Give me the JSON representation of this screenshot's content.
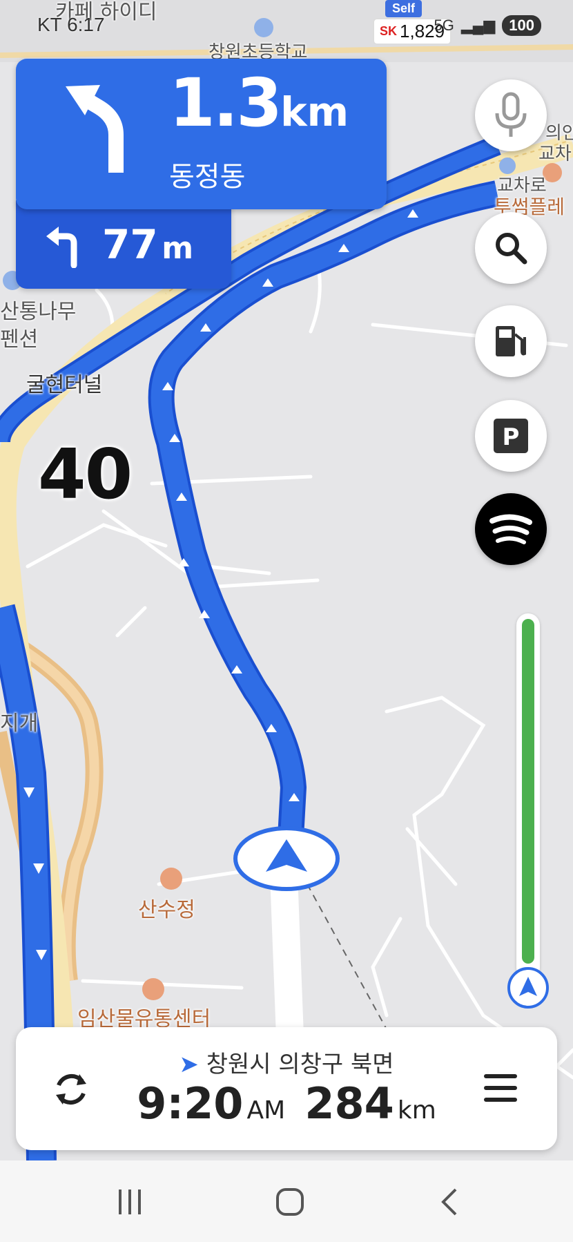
{
  "status_bar": {
    "carrier": "KT",
    "time": "6:17",
    "self_badge": "Self",
    "gas_brand": "SK",
    "gas_price": "1,829",
    "network": "5G",
    "battery": "100"
  },
  "map_labels": {
    "cafe": "카페 하이디",
    "school": "창원초등학교",
    "tunnel": "굴현터널",
    "pension_1": "산통나무",
    "pension_2": "펜션",
    "jigae": "지개",
    "sansujeong": "산수정",
    "logistics": "임산물유통센터",
    "right_1": "의안",
    "right_2": "교차",
    "right_3": "교차로",
    "right_4": "투썸플레"
  },
  "guidance": {
    "distance_value": "1.3",
    "distance_unit": "km",
    "street": "동정동",
    "next_distance_value": "77",
    "next_distance_unit": "m"
  },
  "speed_limit": "40",
  "route_progress": 0.97,
  "bottom_bar": {
    "destination": "창원시 의창구 북면",
    "eta_time": "9:20",
    "eta_suffix": "AM",
    "remaining_distance": "284",
    "remaining_unit": "km"
  },
  "icons": {
    "turn_main": "turn-left-arrow-icon",
    "turn_next": "turn-left-small-icon",
    "mic": "microphone-icon",
    "search": "search-icon",
    "fuel": "fuel-pump-icon",
    "parking": "parking-icon",
    "spotify": "spotify-icon",
    "reroute": "refresh-icon",
    "menu": "hamburger-menu-icon"
  },
  "colors": {
    "route_blue": "#2f6de6",
    "turn_card_blue": "#2f6de6",
    "progress_green": "#4cb04e"
  }
}
